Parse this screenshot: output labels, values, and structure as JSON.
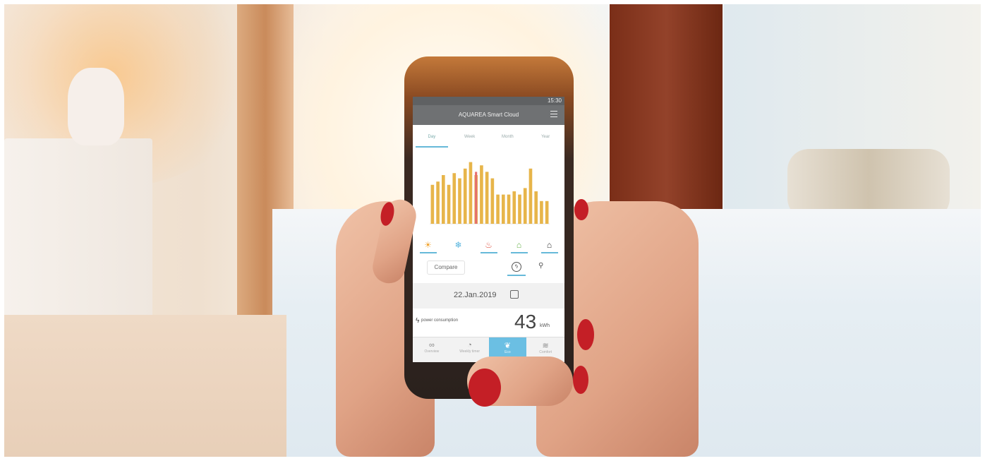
{
  "app": {
    "title": "AQUAREA Smart Cloud",
    "status_time": "15:30"
  },
  "tabs": [
    "Day",
    "Week",
    "Month",
    "Year"
  ],
  "chart_data": {
    "type": "bar",
    "series": [
      {
        "values": [
          60,
          65,
          75,
          60,
          78,
          70,
          85,
          95,
          75,
          90,
          80,
          70,
          45,
          45,
          45,
          50,
          45,
          55,
          85,
          50,
          35,
          35
        ]
      },
      {
        "values": [
          0,
          0,
          0,
          0,
          0,
          0,
          0,
          0,
          80,
          0,
          0,
          0,
          0,
          0,
          0,
          0,
          0,
          0,
          0,
          0,
          0,
          0
        ]
      }
    ],
    "colors": {
      "bars": "#e7b54a",
      "highlight": "#e56f6f"
    }
  },
  "modes": [
    "sun-icon",
    "snowflake-icon",
    "tap-icon",
    "house-icon",
    "house-heat-icon"
  ],
  "compare_label": "Compare",
  "date": "22.Jan.2019",
  "consumption": {
    "label": "power consumption",
    "value": "43",
    "unit": "kWh"
  },
  "nav": [
    {
      "label": "Overview",
      "icon": "link-icon"
    },
    {
      "label": "Weekly timer",
      "icon": "clock-icon"
    },
    {
      "label": "Eco",
      "icon": "leaf-icon"
    },
    {
      "label": "Comfort",
      "icon": "wave-icon"
    }
  ]
}
